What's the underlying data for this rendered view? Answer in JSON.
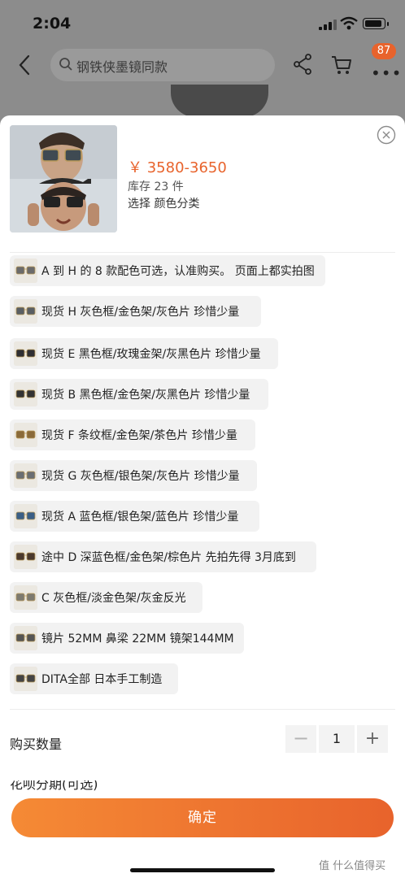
{
  "status": {
    "time": "2:04"
  },
  "nav": {
    "search_text": "钢铁侠墨镜同款",
    "cart_badge": "87",
    "more": "•••"
  },
  "product": {
    "price": "￥ 3580-3650",
    "stock": "库存 23 件",
    "choose": "选择  颜色分类"
  },
  "options": [
    {
      "label": "A 到 H 的 8 款配色可选，认准购买。 页面上都实拍图"
    },
    {
      "label": "现货  H 灰色框/金色架/灰色片 珍惜少量"
    },
    {
      "label": "现货 E 黑色框/玫瑰金架/灰黑色片 珍惜少量"
    },
    {
      "label": "现货 B 黑色框/金色架/灰黑色片 珍惜少量"
    },
    {
      "label": "现货 F 条纹框/金色架/茶色片 珍惜少量"
    },
    {
      "label": "现货 G 灰色框/银色架/灰色片 珍惜少量"
    },
    {
      "label": "现货  A 蓝色框/银色架/蓝色片 珍惜少量"
    },
    {
      "label": "途中 D 深蓝色框/金色架/棕色片 先拍先得 3月底到"
    },
    {
      "label": "C 灰色框/淡金色架/灰金反光"
    },
    {
      "label": "镜片 52MM 鼻梁 22MM 镜架144MM"
    },
    {
      "label": "DITA全部 日本手工制造"
    }
  ],
  "quantity": {
    "label": "购买数量",
    "minus": "−",
    "value": "1",
    "plus": "+"
  },
  "installment": {
    "label": "花呗分期(可选)"
  },
  "confirm_label": "确定",
  "watermark": "值 什么值得买",
  "colors": {
    "accent": "#e8632c",
    "gradient_start": "#f58a35"
  }
}
